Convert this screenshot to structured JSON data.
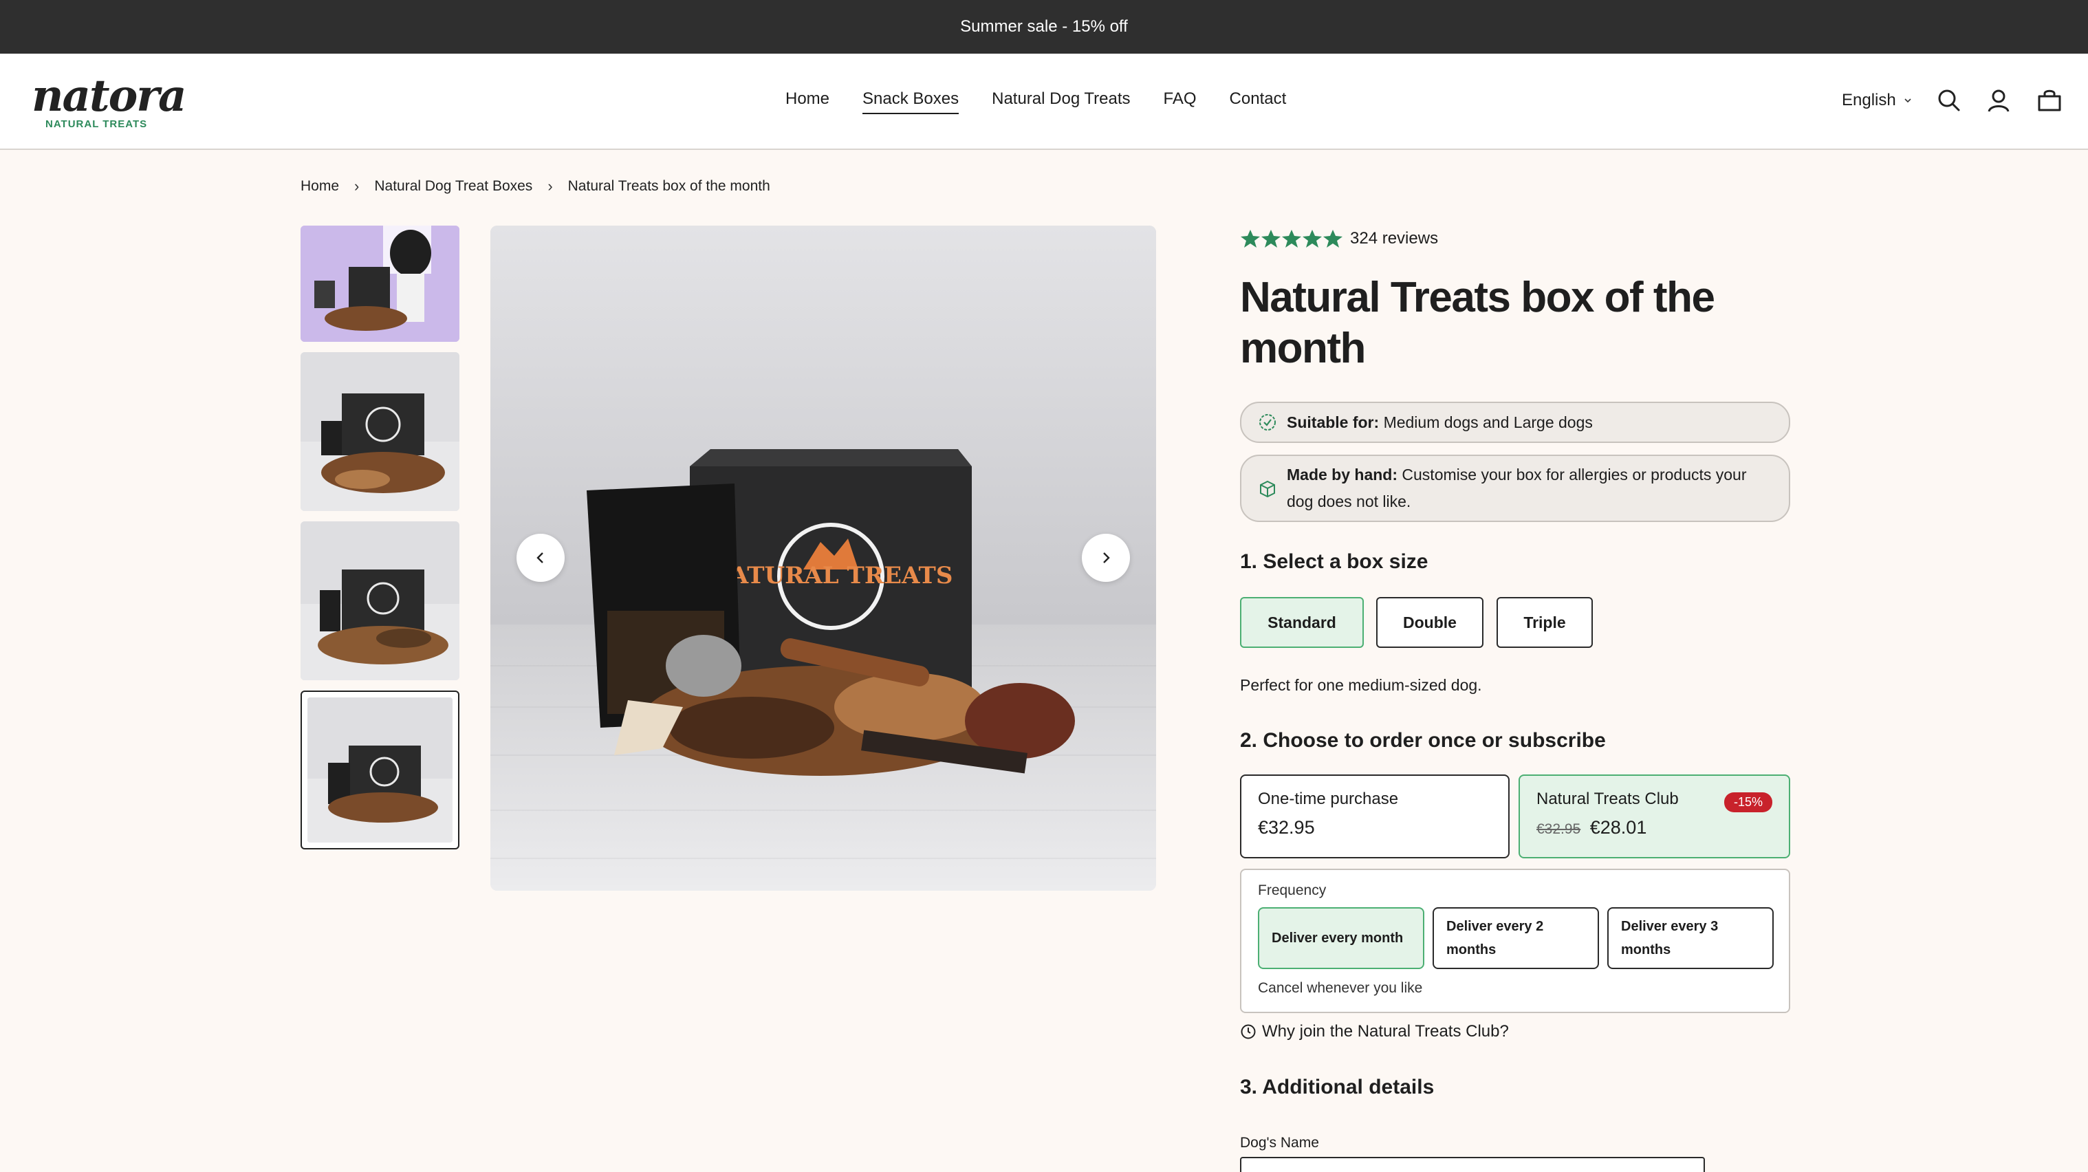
{
  "announcement": "Summer sale - 15% off",
  "logo": {
    "word": "natora",
    "sub": "NATURAL TREATS"
  },
  "nav": [
    "Home",
    "Snack Boxes",
    "Natural Dog Treats",
    "FAQ",
    "Contact"
  ],
  "nav_active": "Snack Boxes",
  "header": {
    "language": "English"
  },
  "breadcrumb": [
    "Home",
    "Natural Dog Treat Boxes",
    "Natural Treats box of the month"
  ],
  "product": {
    "rating_stars": 5,
    "reviews": "324 reviews",
    "title": "Natural Treats box of the month",
    "suitable_label": "Suitable for:",
    "suitable_text": "Medium dogs and Large dogs",
    "handmade_label": "Made by hand:",
    "handmade_text": "Customise your box for allergies or products your dog does not like.",
    "box_label": "NATURAL TREATS"
  },
  "step1": {
    "title": "1. Select a box size",
    "sizes": [
      "Standard",
      "Double",
      "Triple"
    ],
    "selected": "Standard",
    "note": "Perfect for one medium-sized dog."
  },
  "step2": {
    "title": "2. Choose to order once or subscribe",
    "one_time": {
      "name": "One-time purchase",
      "price": "€32.95"
    },
    "club": {
      "name": "Natural Treats Club",
      "badge": "-15%",
      "old_price": "€32.95",
      "price": "€28.01"
    },
    "frequency_label": "Frequency",
    "frequencies": [
      "Deliver every month",
      "Deliver every 2 months",
      "Deliver every 3 months"
    ],
    "frequency_selected": "Deliver every month",
    "cancel_note": "Cancel whenever you like",
    "why": "Why join the Natural Treats Club?"
  },
  "step3": {
    "title": "3. Additional details",
    "dog_name_label": "Dog's Name"
  },
  "colors": {
    "accent_green": "#4caf73",
    "star_green": "#2d8a5b",
    "sale_red": "#c8222b",
    "topbar": "#2f2f2f"
  }
}
